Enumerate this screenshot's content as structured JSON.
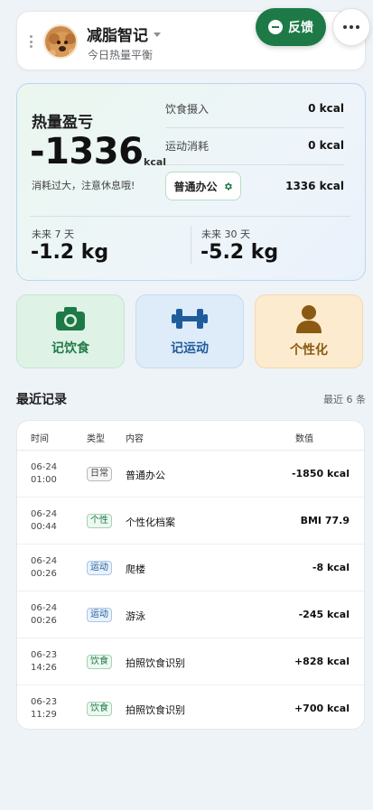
{
  "header": {
    "app_title": "减脂智记",
    "subtitle": "今日热量平衡",
    "feedback_label": "反馈"
  },
  "summary": {
    "title": "热量盈亏",
    "balance_value": "-1336",
    "balance_unit": "kcal",
    "note": "消耗过大，注意休息哦!",
    "intake_label": "饮食摄入",
    "intake_value": "0 kcal",
    "exercise_label": "运动消耗",
    "exercise_value": "0 kcal",
    "mode_label": "普通办公",
    "mode_value": "1336 kcal",
    "forecast_7_label": "未来 7 天",
    "forecast_7_value": "-1.2 kg",
    "forecast_30_label": "未来 30 天",
    "forecast_30_value": "-5.2 kg"
  },
  "actions": {
    "food": "记饮食",
    "sport": "记运动",
    "personal": "个性化"
  },
  "records": {
    "title": "最近记录",
    "count": "最近 6 条",
    "headers": {
      "time": "时间",
      "type": "类型",
      "content": "内容",
      "value": "数值"
    },
    "rows": [
      {
        "date": "06-24",
        "time": "01:00",
        "type": "日常",
        "content": "普通办公",
        "value": "-1850 kcal"
      },
      {
        "date": "06-24",
        "time": "00:44",
        "type": "个性",
        "content": "个性化档案",
        "value": "BMI 77.9"
      },
      {
        "date": "06-24",
        "time": "00:26",
        "type": "运动",
        "content": "爬楼",
        "value": "-8 kcal"
      },
      {
        "date": "06-24",
        "time": "00:26",
        "type": "运动",
        "content": "游泳",
        "value": "-245 kcal"
      },
      {
        "date": "06-23",
        "time": "14:26",
        "type": "饮食",
        "content": "拍照饮食识别",
        "value": "+828 kcal"
      },
      {
        "date": "06-23",
        "time": "11:29",
        "type": "饮食",
        "content": "拍照饮食识别",
        "value": "+700 kcal"
      }
    ]
  },
  "colors": {
    "brand_green": "#1d7a46",
    "sport_blue": "#1f5c9c",
    "personal_brown": "#8a5a12"
  }
}
